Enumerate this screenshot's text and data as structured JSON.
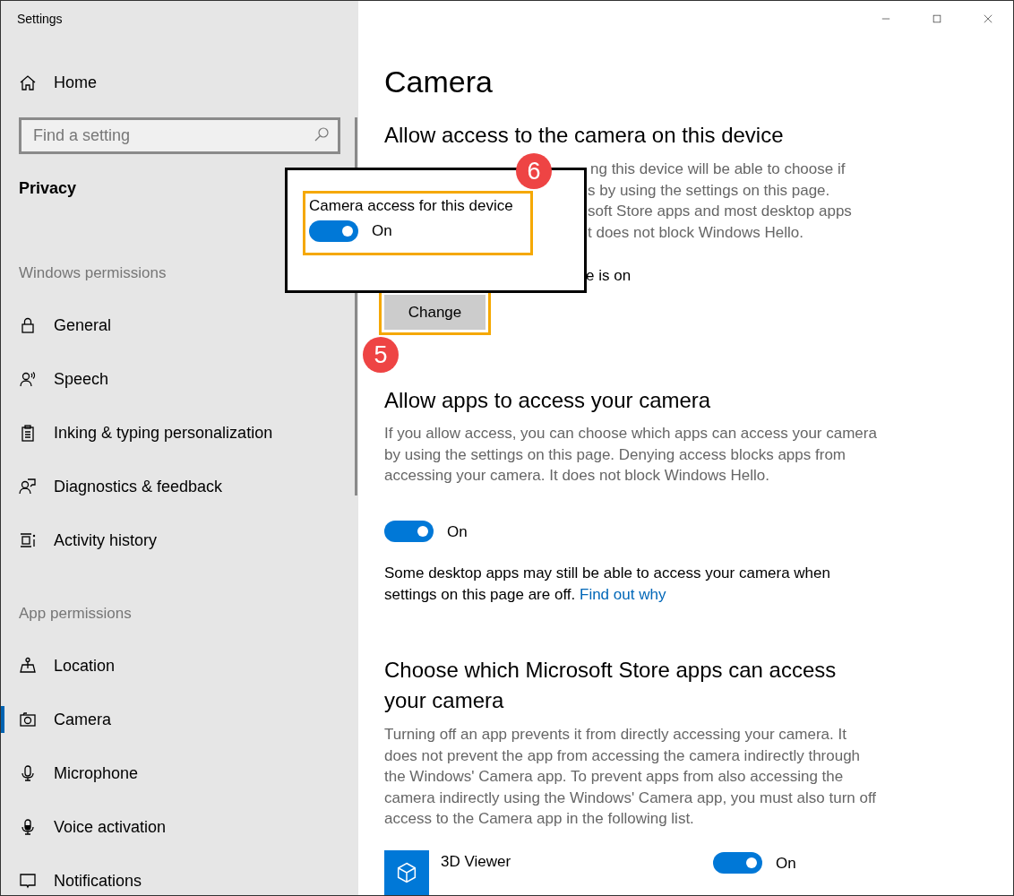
{
  "window": {
    "title": "Settings"
  },
  "sidebar": {
    "home": {
      "label": "Home"
    },
    "search": {
      "placeholder": "Find a setting"
    },
    "section_title": "Privacy",
    "groups": [
      {
        "heading": "Windows permissions",
        "items": [
          {
            "label": "General",
            "selected": false
          },
          {
            "label": "Speech",
            "selected": false
          },
          {
            "label": "Inking & typing personalization",
            "selected": false
          },
          {
            "label": "Diagnostics & feedback",
            "selected": false
          },
          {
            "label": "Activity history",
            "selected": false
          }
        ]
      },
      {
        "heading": "App permissions",
        "items": [
          {
            "label": "Location",
            "selected": false
          },
          {
            "label": "Camera",
            "selected": true
          },
          {
            "label": "Microphone",
            "selected": false
          },
          {
            "label": "Voice activation",
            "selected": false
          },
          {
            "label": "Notifications",
            "selected": false
          }
        ]
      }
    ]
  },
  "main": {
    "title": "Camera",
    "device_section": {
      "heading": "Allow access to the camera on this device",
      "description_fragments": [
        "ng this device will be able to choose if",
        "s by using the settings on this page.",
        "soft Store apps and most desktop apps",
        "t does not block Windows Hello."
      ],
      "status_fragment": "e is on",
      "button": "Change"
    },
    "apps_section": {
      "heading": "Allow apps to access your camera",
      "description": "If you allow access, you can choose which apps can access your camera by using the settings on this page. Denying access blocks apps from accessing your camera. It does not block Windows Hello.",
      "toggle": {
        "on": true,
        "label": "On"
      },
      "note": {
        "text": "Some desktop apps may still be able to access your camera when settings on this page are off.",
        "link": "Find out why"
      }
    },
    "store_section": {
      "heading": "Choose which Microsoft Store apps can access your camera",
      "description": "Turning off an app prevents it from directly accessing your camera. It does not prevent the app from accessing the camera indirectly through the Windows' Camera app. To prevent apps from also accessing the camera indirectly using the Windows' Camera app, you must also turn off access to the Camera app in the following list.",
      "apps": [
        {
          "name": "3D Viewer",
          "toggle": {
            "on": true,
            "label": "On"
          }
        }
      ]
    }
  },
  "popup": {
    "label": "Camera access for this device",
    "toggle": {
      "on": true,
      "label": "On"
    }
  },
  "annotations": [
    {
      "number": "5"
    },
    {
      "number": "6"
    }
  ]
}
